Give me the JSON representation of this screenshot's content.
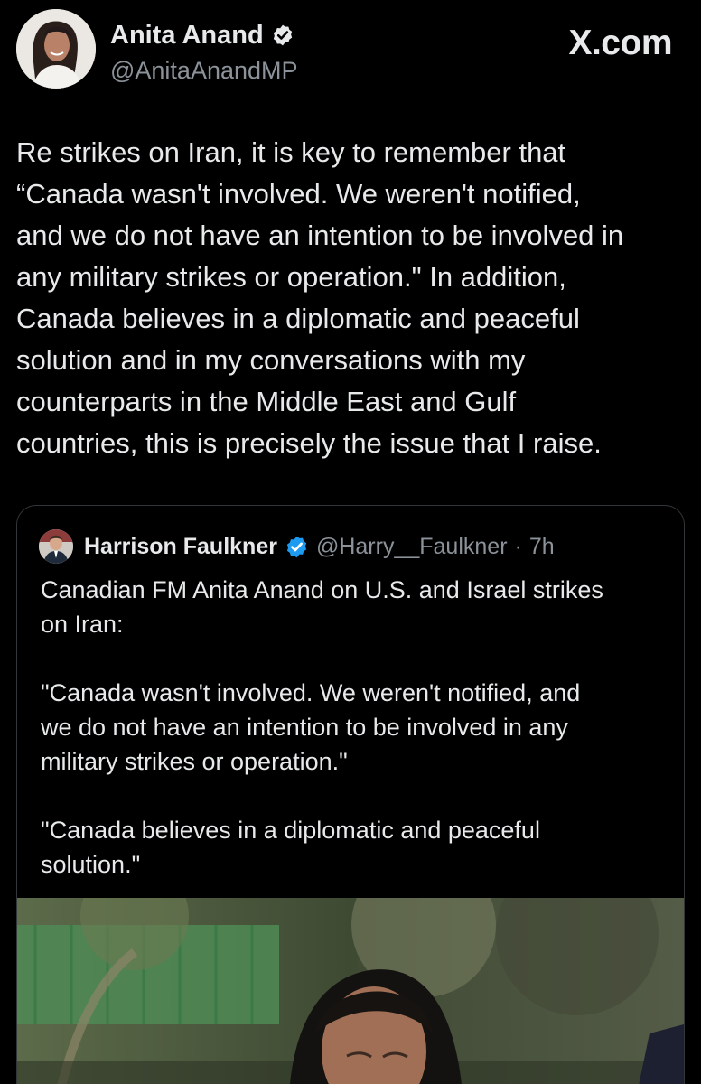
{
  "post": {
    "author_name": "Anita Anand",
    "author_handle": "@AnitaAnandMP",
    "site": "X.com",
    "text": "Re strikes on Iran, it is key to remember that\n“Canada wasn't involved. We weren't notified,\nand we do not have an intention to be involved in\nany military strikes or operation.\" In addition,\nCanada believes in a diplomatic and peaceful\nsolution and in my conversations with my\ncounterparts in the Middle East and Gulf\ncountries, this is precisely the issue that I raise."
  },
  "quote": {
    "author_name": "Harrison Faulkner",
    "author_handle": "@Harry__Faulkner",
    "separator": "·",
    "time": "7h",
    "text": "Canadian FM Anita Anand on U.S. and Israel strikes\non Iran:\n\n\"Canada wasn't involved. We weren't notified, and\nwe do not have an intention to be involved in any\nmilitary strikes or operation.\"\n\n\"Canada believes in a diplomatic and peaceful\nsolution.\""
  },
  "icons": {
    "verified": "verified-badge-icon"
  },
  "colors": {
    "background": "#000000",
    "text_primary": "#e7e9ea",
    "text_secondary": "#8b9299",
    "verified_blue": "#1d9bf0",
    "card_border": "#333639"
  }
}
